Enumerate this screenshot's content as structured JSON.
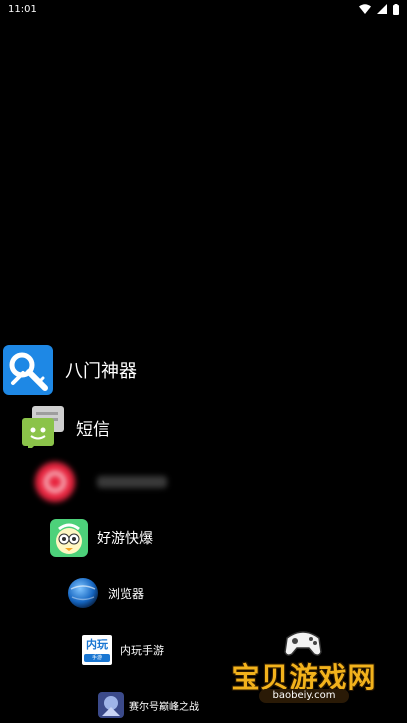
{
  "status_bar": {
    "time": "11:01"
  },
  "apps": [
    {
      "label": "八门神器",
      "icon": "key-wrench-icon"
    },
    {
      "label": "短信",
      "icon": "sms-icon"
    },
    {
      "label": "",
      "icon": "red-circle-icon"
    },
    {
      "label": "好游快爆",
      "icon": "haoyou-kuaibao-icon"
    },
    {
      "label": "浏览器",
      "icon": "globe-icon"
    },
    {
      "label": "内玩手游",
      "icon": "neiwan-icon",
      "icon_text": "内玩",
      "icon_subtext": "手游"
    },
    {
      "label": "赛尔号巅峰之战",
      "icon": "seer-game-icon"
    }
  ],
  "watermark": {
    "title": "宝贝游戏网",
    "url": "baobeiy.com"
  }
}
